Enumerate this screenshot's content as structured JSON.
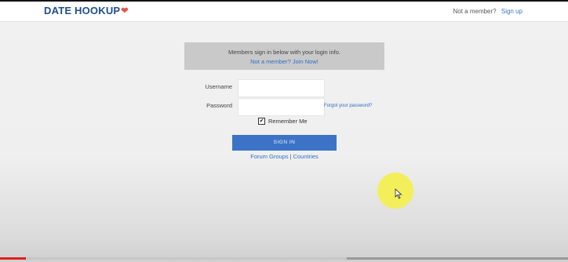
{
  "header": {
    "logo_text": "DATE HOOKUP",
    "logo_icon": "heart-icon",
    "not_member_text": "Not a member?",
    "signup_link": "Sign up"
  },
  "info": {
    "line1": "Members sign in below with your login info.",
    "line2": "Not a member? Join Now!"
  },
  "form": {
    "username_label": "Username",
    "username_value": "",
    "password_label": "Password",
    "password_value": "",
    "forgot_link": "Forgot your password?",
    "remember_label": "Remember Me",
    "remember_checked": true,
    "signin_label": "SIGN IN"
  },
  "footer": {
    "link1": "Forum Groups",
    "separator": "|",
    "link2": "Countries"
  },
  "video": {
    "progress_played": 0.045,
    "progress_buffered": 0.61
  },
  "colors": {
    "brand": "#1f4e8c",
    "heart": "#e4574a",
    "link": "#2f6ec0",
    "button": "#3c73c7",
    "cursor_highlight": "#f4ef4a",
    "progress": "#e01f1f"
  }
}
